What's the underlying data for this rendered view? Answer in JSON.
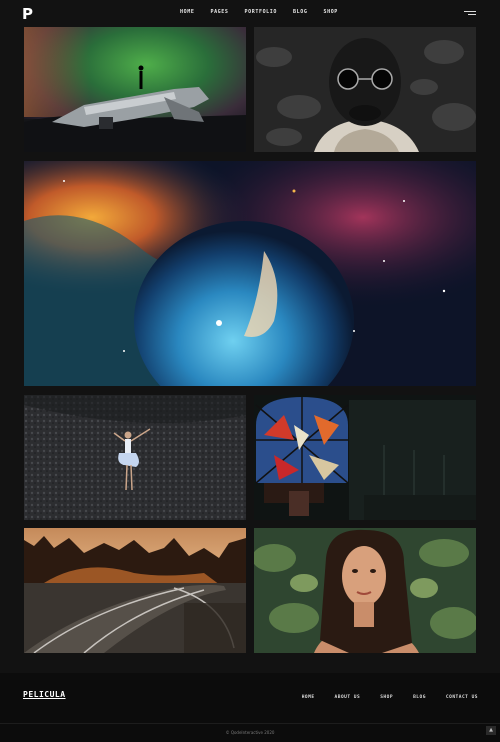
{
  "header": {
    "logo": "P",
    "nav": [
      "HOME",
      "PAGES",
      "PORTFOLIO",
      "BLOG",
      "SHOP"
    ],
    "menu_icon": "hamburger-icon"
  },
  "gallery": [
    {
      "name": "aurora-plane-wreck",
      "desc": "person standing on airplane wreck under green aurora"
    },
    {
      "name": "man-sunglasses-portrait",
      "desc": "black and white portrait of man with round sunglasses"
    },
    {
      "name": "bubble-nebula",
      "desc": "colorful nebula space image"
    },
    {
      "name": "woman-lying-on-rocks",
      "desc": "woman in white dress lying on dark gravel"
    },
    {
      "name": "stained-glass-window",
      "desc": "stained glass window in dark church"
    },
    {
      "name": "railway-tracks-autumn",
      "desc": "curving railway tracks at sunset with autumn forest"
    },
    {
      "name": "woman-portrait-leaves",
      "desc": "portrait of woman among green leaves"
    }
  ],
  "footer": {
    "logo": "PELICULA",
    "nav": [
      "HOME",
      "ABOUT US",
      "SHOP",
      "BLOG",
      "CONTACT US"
    ],
    "copyright": "© QodeInteractive 2020",
    "to_top_icon": "arrow-up-icon"
  }
}
